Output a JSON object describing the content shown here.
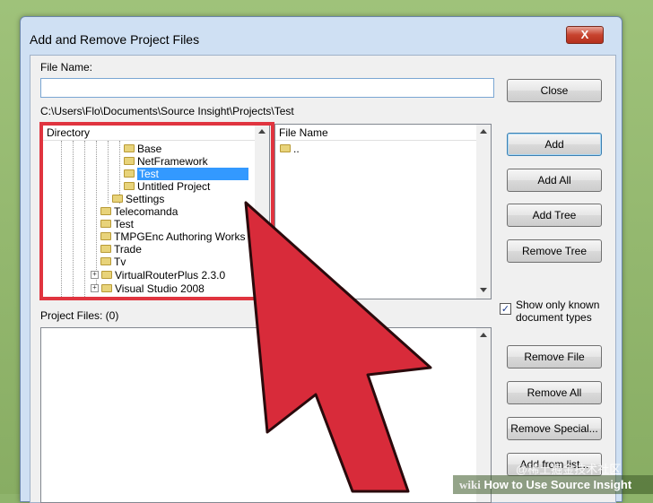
{
  "window": {
    "title": "Add and Remove Project Files",
    "close_glyph": "X"
  },
  "file_name": {
    "label": "File Name:",
    "value": "",
    "path": "C:\\Users\\Flo\\Documents\\Source Insight\\Projects\\Test"
  },
  "directory": {
    "header": "Directory",
    "items": [
      {
        "label": "Base"
      },
      {
        "label": "NetFramework"
      },
      {
        "label": "Test",
        "selected": true
      },
      {
        "label": "Untitled Project"
      },
      {
        "label": "Settings"
      },
      {
        "label": "Telecomanda"
      },
      {
        "label": "Test"
      },
      {
        "label": "TMPGEnc Authoring Works"
      },
      {
        "label": "Trade"
      },
      {
        "label": "Tv"
      },
      {
        "label": "VirtualRouterPlus 2.3.0",
        "expander": "+"
      },
      {
        "label": "Visual Studio 2008",
        "expander": "+"
      }
    ]
  },
  "file_list": {
    "header": "File Name",
    "items": [
      ".."
    ]
  },
  "buttons": {
    "close": "Close",
    "add": "Add",
    "add_all": "Add All",
    "add_tree": "Add Tree",
    "remove_tree": "Remove Tree",
    "remove_file": "Remove File",
    "remove_all": "Remove All",
    "remove_special": "Remove Special...",
    "add_from_list": "Add from list..."
  },
  "option": {
    "show_known": "Show only known",
    "show_known_2": "document types",
    "checked": true,
    "check_glyph": "✓"
  },
  "project_files": {
    "label": "Project Files: (0)"
  },
  "branding": {
    "wiki": "wiki",
    "how_to": "How to Use Source Insight",
    "watermark": "@稀土掘金技术社区"
  },
  "colors": {
    "highlight": "#e0343f",
    "arrow": "#d82b3a",
    "selection": "#3399ff"
  }
}
